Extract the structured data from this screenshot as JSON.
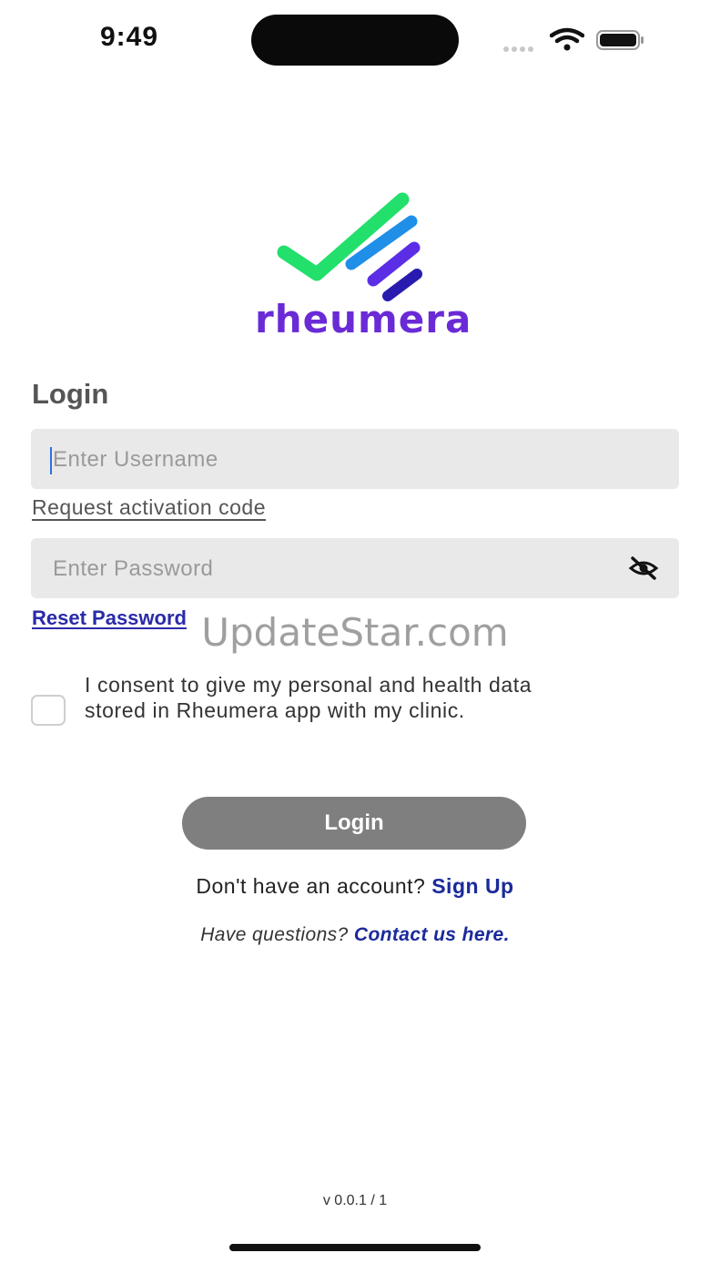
{
  "status_bar": {
    "time": "9:49"
  },
  "brand": {
    "name": "rheumera",
    "colors": {
      "green": "#22e06b",
      "blue": "#1f8fe8",
      "purple": "#5b2ee6",
      "navy": "#2a1bb0",
      "wordmark": "#6a2ad6"
    }
  },
  "login": {
    "title": "Login",
    "username_placeholder": "Enter Username",
    "request_code_link": "Request activation code",
    "password_placeholder": "Enter Password",
    "password_visibility_icon": "eye-off-icon",
    "reset_password_link": "Reset Password",
    "consent_text": "I consent to give my personal and health data stored in Rheumera app with my clinic.",
    "consent_checked": false,
    "login_button": "Login"
  },
  "footer": {
    "no_account_text": "Don't have an account?",
    "sign_up_link": "Sign Up",
    "questions_text": "Have questions?",
    "contact_link": "Contact us here.",
    "version": "v 0.0.1 / 1"
  },
  "watermark": "UpdateStar.com"
}
